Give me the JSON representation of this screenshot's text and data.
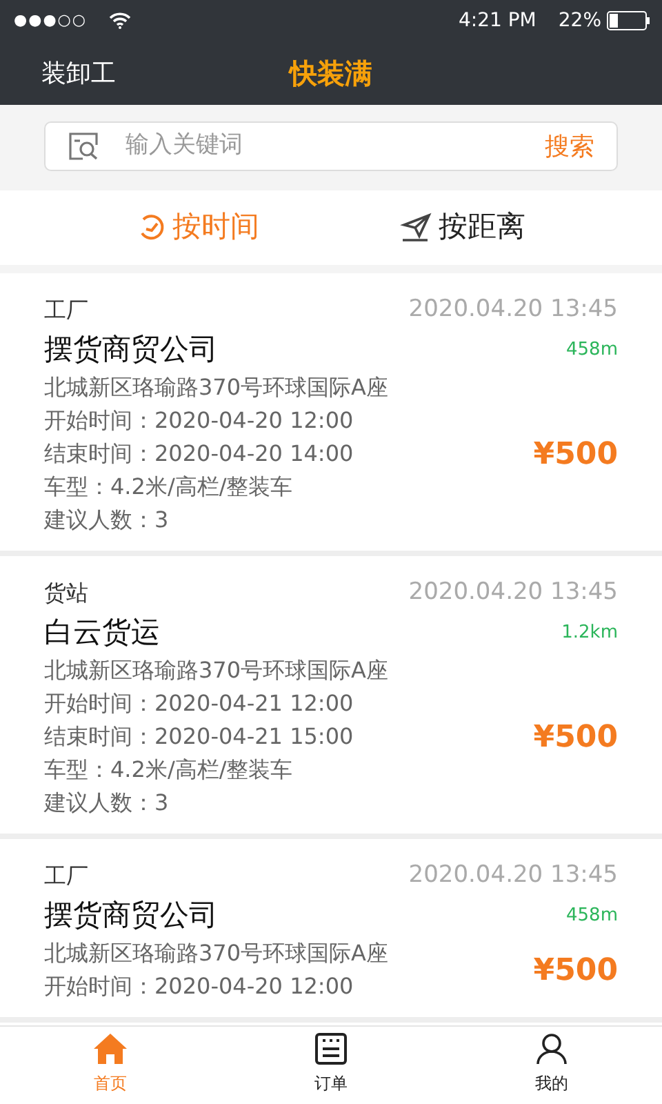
{
  "status_bar": {
    "signal_dots": "●●●○○",
    "time": "4:21 PM",
    "battery": "22%"
  },
  "header": {
    "left": "装卸工",
    "title": "快装满"
  },
  "search": {
    "placeholder": "输入关键词",
    "button": "搜索"
  },
  "sort_tabs": [
    {
      "label": "按时间",
      "kind": "time",
      "selected": true
    },
    {
      "label": "按距离",
      "kind": "distance",
      "selected": false
    }
  ],
  "orders": [
    {
      "type": "工厂",
      "date": "2020.04.20 13:45",
      "name": "摆货商贸公司",
      "distance": "458m",
      "price": "¥500",
      "lines": [
        "北城新区珞瑜路370号环球国际A座",
        "开始时间：2020-04-20 12:00",
        "结束时间：2020-04-20 14:00",
        "车型：4.2米/高栏/整装车",
        "建议人数：3"
      ]
    },
    {
      "type": "货站",
      "date": "2020.04.20 13:45",
      "name": "白云货运",
      "distance": "1.2km",
      "price": "¥500",
      "lines": [
        "北城新区珞瑜路370号环球国际A座",
        "开始时间：2020-04-21 12:00",
        "结束时间：2020-04-21 15:00",
        "车型：4.2米/高栏/整装车",
        "建议人数：3"
      ]
    },
    {
      "type": "工厂",
      "date": "2020.04.20 13:45",
      "name": "摆货商贸公司",
      "distance": "458m",
      "price": "¥500",
      "lines": [
        "北城新区珞瑜路370号环球国际A座",
        "开始时间：2020-04-20 12:00"
      ]
    }
  ],
  "tab_bar": [
    {
      "label": "首页",
      "kind": "home",
      "selected": true
    },
    {
      "label": "订单",
      "kind": "orders",
      "selected": false
    },
    {
      "label": "我的",
      "kind": "profile",
      "selected": false
    }
  ]
}
